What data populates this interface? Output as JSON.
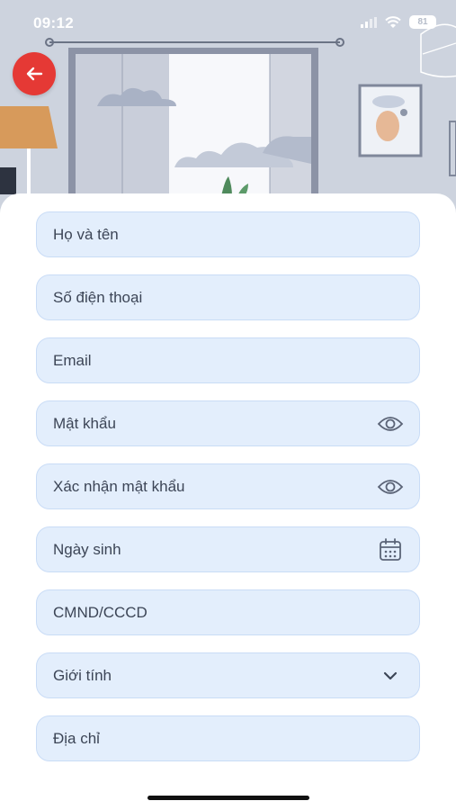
{
  "status_bar": {
    "time": "09:12",
    "battery": "81"
  },
  "form": {
    "full_name_placeholder": "Họ và tên",
    "phone_placeholder": "Số điện thoại",
    "email_placeholder": "Email",
    "password_placeholder": "Mật khẩu",
    "confirm_password_placeholder": "Xác nhận mật khẩu",
    "birthday_placeholder": "Ngày sinh",
    "id_number_placeholder": "CMND/CCCD",
    "gender_label": "Giới tính",
    "address_placeholder": "Địa chỉ"
  },
  "icons": {
    "back": "arrow-left-icon",
    "password_toggle": "eye-icon",
    "birthday": "calendar-icon",
    "gender": "chevron-down-icon"
  },
  "colors": {
    "accent": "#e53935",
    "field_bg": "#e3eefc",
    "field_border": "#c9dcf6",
    "hero_bg": "#cdd3de"
  }
}
